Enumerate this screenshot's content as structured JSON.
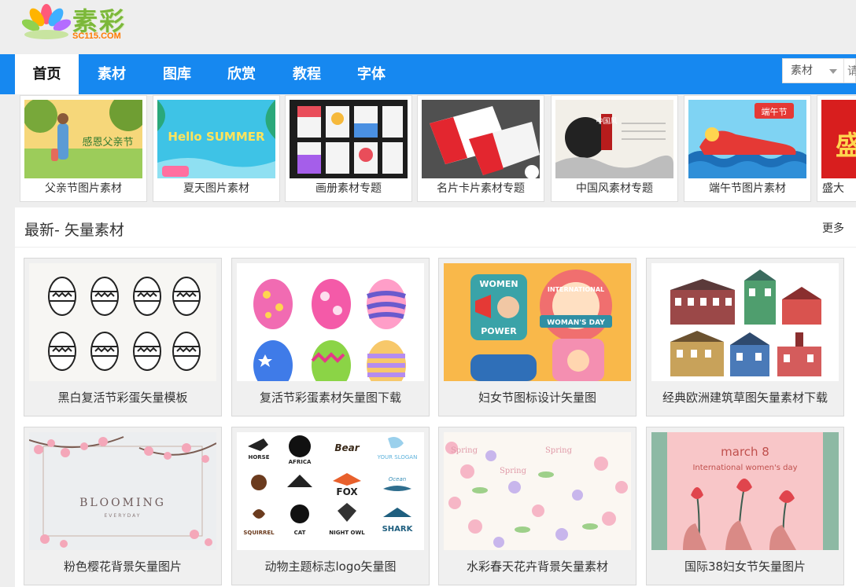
{
  "logo": {
    "name": "素彩",
    "domain": "SC115.COM"
  },
  "nav": {
    "items": [
      {
        "label": "首页",
        "active": true
      },
      {
        "label": "素材",
        "active": false
      },
      {
        "label": "图库",
        "active": false
      },
      {
        "label": "欣赏",
        "active": false
      },
      {
        "label": "教程",
        "active": false
      },
      {
        "label": "字体",
        "active": false
      }
    ],
    "search": {
      "selected": "素材",
      "placeholder": "请"
    }
  },
  "topics": [
    {
      "label": "父亲节图片素材",
      "thumb_text": "感恩父亲节"
    },
    {
      "label": "夏天图片素材",
      "thumb_text": "Hello SUMMER"
    },
    {
      "label": "画册素材专题",
      "thumb_text": ""
    },
    {
      "label": "名片卡片素材专题",
      "thumb_text": ""
    },
    {
      "label": "中国风素材专题",
      "thumb_text": "中国风"
    },
    {
      "label": "端午节图片素材",
      "thumb_text": "端午节"
    },
    {
      "label": "盛大",
      "thumb_text": "盛"
    }
  ],
  "section": {
    "title": "最新- 矢量素材",
    "more": "更多",
    "cards": [
      {
        "label": "黑白复活节彩蛋矢量模板"
      },
      {
        "label": "复活节彩蛋素材矢量图下载"
      },
      {
        "label": "妇女节图标设计矢量图",
        "thumb_texts": [
          "WOMEN",
          "POWER",
          "INTERNATIONAL",
          "WOMAN'S DAY"
        ]
      },
      {
        "label": "经典欧洲建筑草图矢量素材下载"
      },
      {
        "label": "粉色樱花背景矢量图片",
        "thumb_texts": [
          "BLOOMING",
          "EVERYDAY"
        ]
      },
      {
        "label": "动物主题标志logo矢量图",
        "thumb_texts": [
          "HORSE",
          "AFRICA",
          "Bear",
          "YOUR SLOGAN",
          "FOX",
          "Ocean",
          "SQUIRREL",
          "CAT",
          "NIGHT OWL",
          "SHARK"
        ]
      },
      {
        "label": "水彩春天花卉背景矢量素材",
        "thumb_texts": [
          "Spring",
          "Spring",
          "Spring"
        ]
      },
      {
        "label": "国际38妇女节矢量图片",
        "thumb_texts": [
          "march 8",
          "International women's day"
        ]
      }
    ]
  },
  "colors": {
    "nav_blue": "#1688f0",
    "page_bg": "#eeeeee",
    "logo_green": "#7cb83a",
    "logo_orange": "#ff7a00"
  }
}
